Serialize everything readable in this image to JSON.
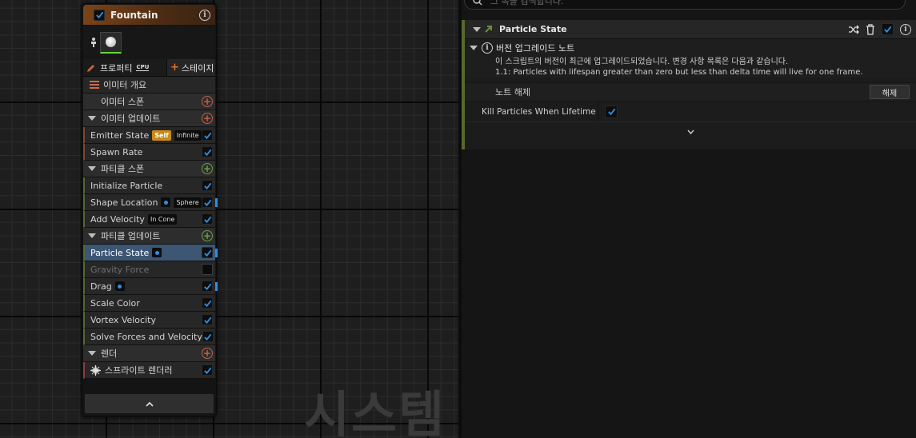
{
  "search": {
    "placeholder": "그 속을 검색합니다."
  },
  "node": {
    "title": "Fountain",
    "tabs": {
      "properties": "프로퍼티",
      "properties_badge": "CPU",
      "stage": "스테이지"
    },
    "rows": {
      "emitter_summary": "이미터 개요",
      "emitter_spawn": "이미터 스폰",
      "emitter_update": "이미터 업데이트",
      "emitter_state": "Emitter State",
      "emitter_state_self": "Self",
      "emitter_state_mode": "Infinite",
      "spawn_rate": "Spawn Rate",
      "particle_spawn": "파티클 스폰",
      "initialize_particle": "Initialize Particle",
      "shape_location": "Shape Location",
      "shape_location_badge": "Sphere",
      "add_velocity": "Add Velocity",
      "add_velocity_badge": "In Cone",
      "particle_update": "파티클 업데이트",
      "particle_state": "Particle State",
      "gravity_force": "Gravity Force",
      "drag": "Drag",
      "scale_color": "Scale Color",
      "vortex_velocity": "Vortex Velocity",
      "solve_forces": "Solve Forces and Velocity",
      "render": "렌더",
      "sprite_renderer": "스프라이트 렌더러"
    }
  },
  "watermark": "시스템",
  "details": {
    "panel_title": "Particle State",
    "notes_title": "버전 업그레이드 노트",
    "notes_line1": "이 스크립트의 버전이 최근에 업그레이드되었습니다. 변경 사항 목록은 다음과 같습니다.",
    "notes_line2": "1.1: Particles with lifespan greater than zero but less than delta time will live for one frame.",
    "dismiss_label": "노트 해제",
    "dismiss_button": "해제",
    "kill_label": "Kill Particles When Lifetime"
  },
  "colors": {
    "accent": "#2a8fe6",
    "node_header": "#7a4419",
    "update_stripe": "#56692c",
    "selected_row": "#3c5674"
  }
}
